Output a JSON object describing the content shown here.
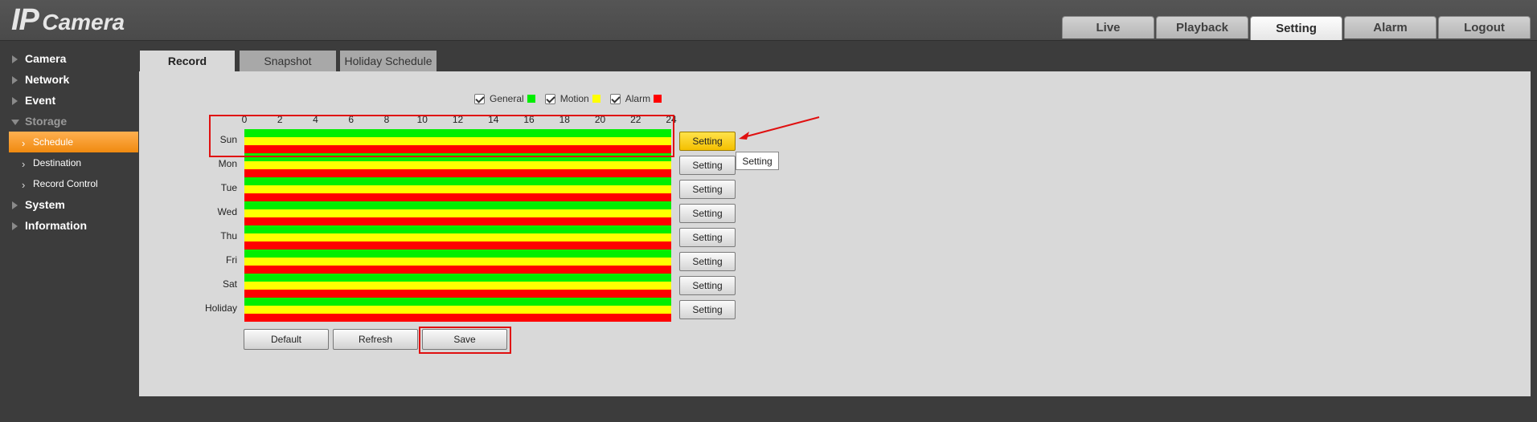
{
  "app": {
    "title_ip": "IP",
    "title_camera": "Camera"
  },
  "top_tabs": [
    {
      "label": "Live",
      "active": false
    },
    {
      "label": "Playback",
      "active": false
    },
    {
      "label": "Setting",
      "active": true
    },
    {
      "label": "Alarm",
      "active": false
    },
    {
      "label": "Logout",
      "active": false
    }
  ],
  "sidebar": {
    "items": [
      {
        "label": "Camera"
      },
      {
        "label": "Network"
      },
      {
        "label": "Event"
      },
      {
        "label": "Storage",
        "expanded": true
      },
      {
        "label": "System"
      },
      {
        "label": "Information"
      }
    ],
    "storage_sub": [
      {
        "label": "Schedule",
        "active": true
      },
      {
        "label": "Destination"
      },
      {
        "label": "Record Control"
      }
    ]
  },
  "content_tabs": [
    {
      "label": "Record",
      "active": true
    },
    {
      "label": "Snapshot"
    },
    {
      "label": "Holiday Schedule"
    }
  ],
  "legend": [
    {
      "label": "General",
      "checked": true,
      "color": "#00ee00"
    },
    {
      "label": "Motion",
      "checked": true,
      "color": "#ffff00"
    },
    {
      "label": "Alarm",
      "checked": true,
      "color": "#ff0000"
    }
  ],
  "hours": [
    "0",
    "2",
    "4",
    "6",
    "8",
    "10",
    "12",
    "14",
    "16",
    "18",
    "20",
    "22",
    "24"
  ],
  "days": [
    "Sun",
    "Mon",
    "Tue",
    "Wed",
    "Thu",
    "Fri",
    "Sat",
    "Holiday"
  ],
  "setting_label": "Setting",
  "tooltip": "Setting",
  "buttons": {
    "default": "Default",
    "refresh": "Refresh",
    "save": "Save"
  },
  "colors": {
    "general": "#00ee00",
    "motion": "#ffff00",
    "alarm": "#ff0000",
    "accent": "#f5a020"
  }
}
